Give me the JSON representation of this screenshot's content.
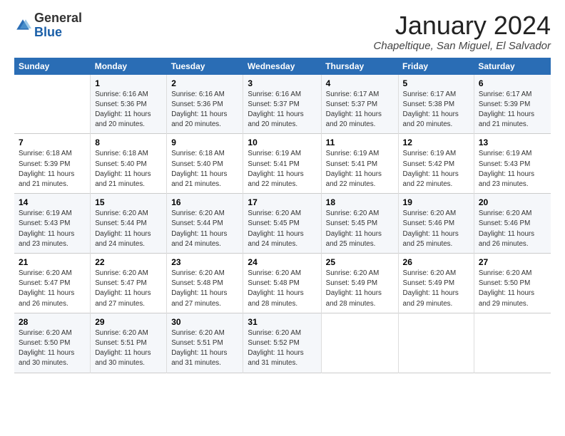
{
  "logo": {
    "general": "General",
    "blue": "Blue"
  },
  "header": {
    "title": "January 2024",
    "subtitle": "Chapeltique, San Miguel, El Salvador"
  },
  "weekdays": [
    "Sunday",
    "Monday",
    "Tuesday",
    "Wednesday",
    "Thursday",
    "Friday",
    "Saturday"
  ],
  "weeks": [
    [
      {
        "day": "",
        "info": ""
      },
      {
        "day": "1",
        "info": "Sunrise: 6:16 AM\nSunset: 5:36 PM\nDaylight: 11 hours\nand 20 minutes."
      },
      {
        "day": "2",
        "info": "Sunrise: 6:16 AM\nSunset: 5:36 PM\nDaylight: 11 hours\nand 20 minutes."
      },
      {
        "day": "3",
        "info": "Sunrise: 6:16 AM\nSunset: 5:37 PM\nDaylight: 11 hours\nand 20 minutes."
      },
      {
        "day": "4",
        "info": "Sunrise: 6:17 AM\nSunset: 5:37 PM\nDaylight: 11 hours\nand 20 minutes."
      },
      {
        "day": "5",
        "info": "Sunrise: 6:17 AM\nSunset: 5:38 PM\nDaylight: 11 hours\nand 20 minutes."
      },
      {
        "day": "6",
        "info": "Sunrise: 6:17 AM\nSunset: 5:39 PM\nDaylight: 11 hours\nand 21 minutes."
      }
    ],
    [
      {
        "day": "7",
        "info": "Sunrise: 6:18 AM\nSunset: 5:39 PM\nDaylight: 11 hours\nand 21 minutes."
      },
      {
        "day": "8",
        "info": "Sunrise: 6:18 AM\nSunset: 5:40 PM\nDaylight: 11 hours\nand 21 minutes."
      },
      {
        "day": "9",
        "info": "Sunrise: 6:18 AM\nSunset: 5:40 PM\nDaylight: 11 hours\nand 21 minutes."
      },
      {
        "day": "10",
        "info": "Sunrise: 6:19 AM\nSunset: 5:41 PM\nDaylight: 11 hours\nand 22 minutes."
      },
      {
        "day": "11",
        "info": "Sunrise: 6:19 AM\nSunset: 5:41 PM\nDaylight: 11 hours\nand 22 minutes."
      },
      {
        "day": "12",
        "info": "Sunrise: 6:19 AM\nSunset: 5:42 PM\nDaylight: 11 hours\nand 22 minutes."
      },
      {
        "day": "13",
        "info": "Sunrise: 6:19 AM\nSunset: 5:43 PM\nDaylight: 11 hours\nand 23 minutes."
      }
    ],
    [
      {
        "day": "14",
        "info": "Sunrise: 6:19 AM\nSunset: 5:43 PM\nDaylight: 11 hours\nand 23 minutes."
      },
      {
        "day": "15",
        "info": "Sunrise: 6:20 AM\nSunset: 5:44 PM\nDaylight: 11 hours\nand 24 minutes."
      },
      {
        "day": "16",
        "info": "Sunrise: 6:20 AM\nSunset: 5:44 PM\nDaylight: 11 hours\nand 24 minutes."
      },
      {
        "day": "17",
        "info": "Sunrise: 6:20 AM\nSunset: 5:45 PM\nDaylight: 11 hours\nand 24 minutes."
      },
      {
        "day": "18",
        "info": "Sunrise: 6:20 AM\nSunset: 5:45 PM\nDaylight: 11 hours\nand 25 minutes."
      },
      {
        "day": "19",
        "info": "Sunrise: 6:20 AM\nSunset: 5:46 PM\nDaylight: 11 hours\nand 25 minutes."
      },
      {
        "day": "20",
        "info": "Sunrise: 6:20 AM\nSunset: 5:46 PM\nDaylight: 11 hours\nand 26 minutes."
      }
    ],
    [
      {
        "day": "21",
        "info": "Sunrise: 6:20 AM\nSunset: 5:47 PM\nDaylight: 11 hours\nand 26 minutes."
      },
      {
        "day": "22",
        "info": "Sunrise: 6:20 AM\nSunset: 5:47 PM\nDaylight: 11 hours\nand 27 minutes."
      },
      {
        "day": "23",
        "info": "Sunrise: 6:20 AM\nSunset: 5:48 PM\nDaylight: 11 hours\nand 27 minutes."
      },
      {
        "day": "24",
        "info": "Sunrise: 6:20 AM\nSunset: 5:48 PM\nDaylight: 11 hours\nand 28 minutes."
      },
      {
        "day": "25",
        "info": "Sunrise: 6:20 AM\nSunset: 5:49 PM\nDaylight: 11 hours\nand 28 minutes."
      },
      {
        "day": "26",
        "info": "Sunrise: 6:20 AM\nSunset: 5:49 PM\nDaylight: 11 hours\nand 29 minutes."
      },
      {
        "day": "27",
        "info": "Sunrise: 6:20 AM\nSunset: 5:50 PM\nDaylight: 11 hours\nand 29 minutes."
      }
    ],
    [
      {
        "day": "28",
        "info": "Sunrise: 6:20 AM\nSunset: 5:50 PM\nDaylight: 11 hours\nand 30 minutes."
      },
      {
        "day": "29",
        "info": "Sunrise: 6:20 AM\nSunset: 5:51 PM\nDaylight: 11 hours\nand 30 minutes."
      },
      {
        "day": "30",
        "info": "Sunrise: 6:20 AM\nSunset: 5:51 PM\nDaylight: 11 hours\nand 31 minutes."
      },
      {
        "day": "31",
        "info": "Sunrise: 6:20 AM\nSunset: 5:52 PM\nDaylight: 11 hours\nand 31 minutes."
      },
      {
        "day": "",
        "info": ""
      },
      {
        "day": "",
        "info": ""
      },
      {
        "day": "",
        "info": ""
      }
    ]
  ]
}
